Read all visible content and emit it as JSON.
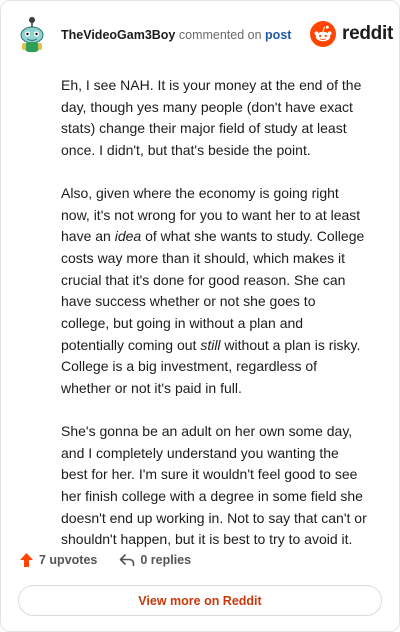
{
  "header": {
    "username": "TheVideoGam3Boy",
    "verb": "commented on",
    "post_link": "post",
    "logo_text": "reddit"
  },
  "comment": {
    "paragraphs": [
      [
        {
          "text": "Eh, I see NAH. It is your money at the end of the day, though yes many people (don't have exact stats) change their major field of study at least once. I didn't, but that's beside the point."
        }
      ],
      [
        {
          "text": "Also, given where the economy is going right now, it's not wrong for you to want her to at least have an "
        },
        {
          "text": "idea",
          "em": true
        },
        {
          "text": " of what she wants to study. College costs way more than it should, which makes it crucial that it's done for good reason. She can have success whether or not she goes to college, but going in without a plan and potentially coming out "
        },
        {
          "text": "still",
          "em": true
        },
        {
          "text": " without a plan is risky. College is a big investment, regardless of whether or not it's paid in full."
        }
      ],
      [
        {
          "text": "She's gonna be an adult on her own some day, and I completely understand you wanting the best for her. I'm sure it wouldn't feel good to see her finish college with a degree in some field she doesn't end up working in. Not to say that can't or shouldn't happen, but it is best to try to avoid it."
        }
      ]
    ]
  },
  "footer": {
    "upvotes": "7 upvotes",
    "replies": "0 replies"
  },
  "view_more_label": "View more on Reddit",
  "colors": {
    "accent": "#ff4500",
    "link": "#1e5aa8",
    "cta_text": "#c8390c"
  },
  "icons": {
    "avatar": "snoo-avatar-icon",
    "logo": "reddit-logo-icon",
    "upvote": "upvote-arrow-icon",
    "reply": "reply-arrow-icon"
  }
}
